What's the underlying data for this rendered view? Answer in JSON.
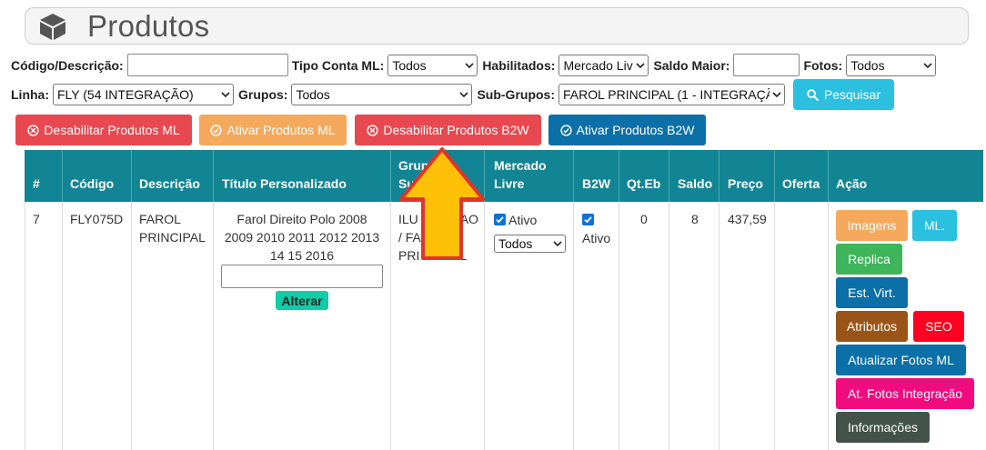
{
  "header": {
    "title": "Produtos"
  },
  "filters": {
    "codigo_label": "Código/Descrição:",
    "codigo_value": "",
    "tipo_conta_label": "Tipo Conta ML:",
    "tipo_conta_value": "Todos",
    "habilitados_label": "Habilitados:",
    "habilitados_value": "Mercado Liv",
    "saldo_label": "Saldo Maior:",
    "saldo_value": "",
    "fotos_label": "Fotos:",
    "fotos_value": "Todos",
    "linha_label": "Linha:",
    "linha_value": "FLY (54 INTEGRAÇÃO)",
    "grupos_label": "Grupos:",
    "grupos_value": "Todos",
    "subgrupos_label": "Sub-Grupos:",
    "subgrupos_value": "FAROL PRINCIPAL (1 - INTEGRAÇÃ"
  },
  "search_button": "Pesquisar",
  "actions": {
    "desabilitar_ml": "Desabilitar Produtos ML",
    "ativar_ml": "Ativar Produtos ML",
    "desabilitar_b2w": "Desabilitar Produtos B2W",
    "ativar_b2w": "Ativar Produtos B2W"
  },
  "table": {
    "headers": {
      "num": "#",
      "codigo": "Código",
      "descricao": "Descrição",
      "titulo": "Título Personalizado",
      "grupo_l1": "Grup",
      "grupo_l2": "Su",
      "mercado_l1": "Mercado",
      "mercado_l2": "Livre",
      "b2w": "B2W",
      "qteb": "Qt.Eb",
      "saldo": "Saldo",
      "preco": "Preço",
      "oferta": "Oferta",
      "acao": "Ação"
    },
    "row": {
      "num": "7",
      "codigo": "FLY075D",
      "descricao_l1": "FAROL",
      "descricao_l2": "PRINCIPAL",
      "titulo_l1": "Farol Direito Polo 2008",
      "titulo_l2": "2009 2010 2011 2012 2013",
      "titulo_l3": "14 15 2016",
      "titulo_input": "",
      "alterar": "Alterar",
      "grupo_l1": "ILU",
      "grupo_l1b": "AO",
      "grupo_l2": "/ FA",
      "grupo_l3": "PRI",
      "grupo_l3b": "L",
      "ml_checked_label": "Ativo",
      "ml_select": "Todos",
      "b2w_label": "Ativo",
      "qteb": "0",
      "saldo": "8",
      "preco": "437,59",
      "oferta": "",
      "buttons": {
        "imagens": "Imagens",
        "ml": "ML.",
        "replica": "Replica",
        "est_virt": "Est. Virt.",
        "atributos": "Atributos",
        "seo": "SEO",
        "atualizar_fotos": "Atualizar Fotos ML",
        "at_fotos_integracao": "At. Fotos Integração",
        "informacoes": "Informações"
      }
    }
  },
  "colors": {
    "header_bg": "#118593",
    "danger": "#e8484f",
    "warning": "#f4a95c",
    "primary": "#0b6fa8",
    "info": "#2bbfe0",
    "success": "#3eb55a",
    "brown": "#9a5417",
    "red": "#ff0022",
    "pink": "#f00b7e",
    "dark": "#44524c",
    "teal": "#11cca6",
    "arrow_fill": "#ffc107",
    "arrow_stroke": "#e0342b"
  }
}
